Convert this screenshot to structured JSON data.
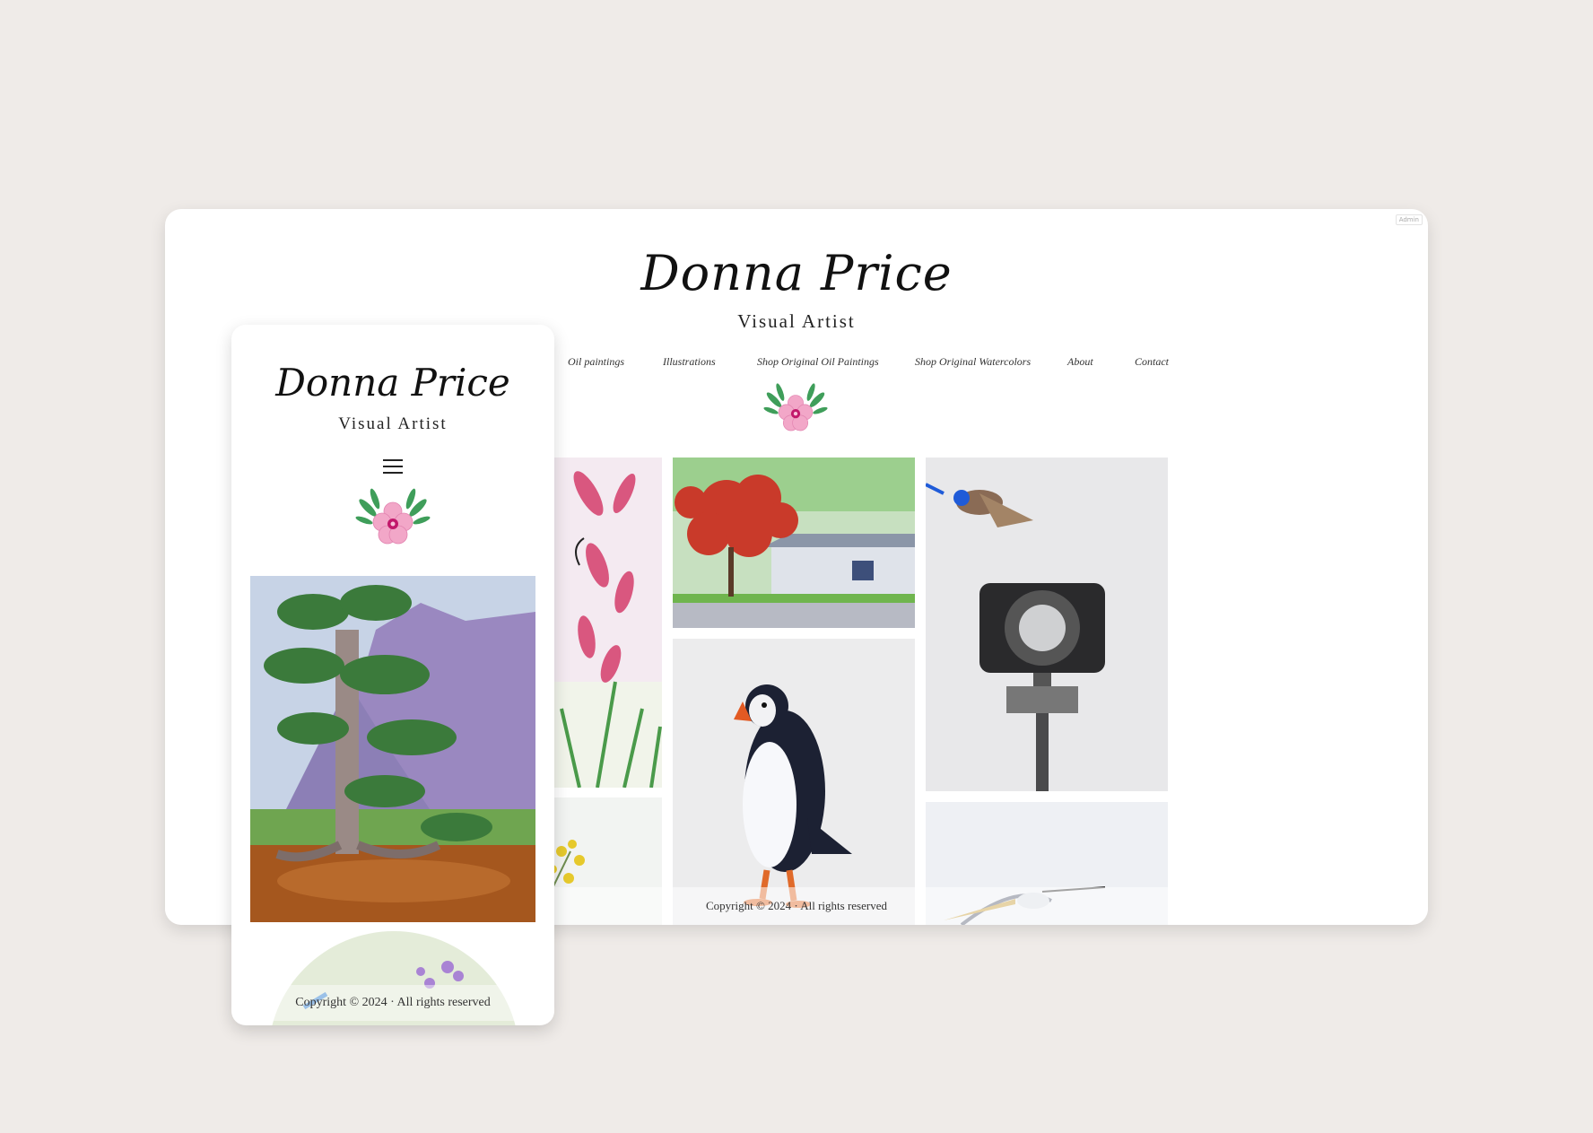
{
  "desktop": {
    "admin_label": "Admin",
    "site_title": "Donna Price",
    "site_subtitle": "Visual Artist",
    "nav": [
      "Oil paintings",
      "Illustrations",
      "Shop Original Oil Paintings",
      "Shop Original Watercolors",
      "About",
      "Contact"
    ],
    "footer": "Copyright © 2024 · All rights reserved"
  },
  "mobile": {
    "site_title": "Donna Price",
    "site_subtitle": "Visual Artist",
    "footer": "Copyright © 2024 · All rights reserved"
  },
  "colors": {
    "background": "#efebe8",
    "flower_pink": "#f2a7c8",
    "flower_center": "#c2186b",
    "leaf_green": "#3f9e5a"
  }
}
